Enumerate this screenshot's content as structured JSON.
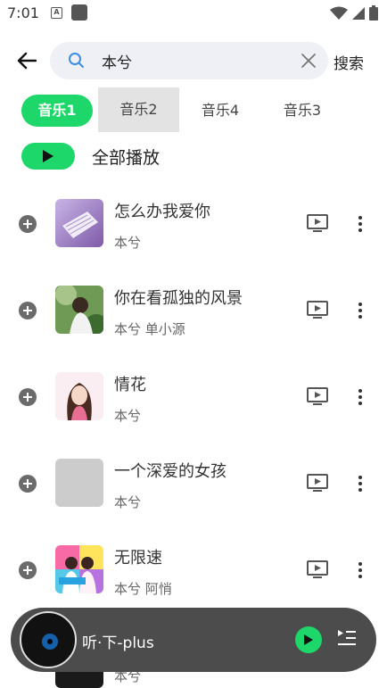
{
  "status_bar": {
    "time": "7:01",
    "notif_letter": "A"
  },
  "search": {
    "query": "本兮",
    "submit_label": "搜索"
  },
  "tabs": [
    {
      "label": "音乐1",
      "active": true
    },
    {
      "label": "音乐2",
      "active": false
    },
    {
      "label": "音乐4",
      "active": false
    },
    {
      "label": "音乐3",
      "active": false
    }
  ],
  "play_all": {
    "label": "全部播放"
  },
  "songs": [
    {
      "title": "怎么办我爱你",
      "artist": "本兮",
      "cover": "purple-paper"
    },
    {
      "title": "你在看孤独的风景",
      "artist": "本兮 单小源",
      "cover": "green-portrait"
    },
    {
      "title": "情花",
      "artist": "本兮",
      "cover": "pink-portrait"
    },
    {
      "title": "一个深爱的女孩",
      "artist": "本兮",
      "cover": "placeholder-gray"
    },
    {
      "title": "无限速",
      "artist": "本兮 阿悄",
      "cover": "colorful-duo"
    }
  ],
  "peek_song": {
    "artist": "本兮"
  },
  "mini_player": {
    "title": "听·下-plus"
  },
  "colors": {
    "accent": "#1ed76a",
    "search_bg": "#eef0f5",
    "player_bg": "#4c4c4c"
  }
}
